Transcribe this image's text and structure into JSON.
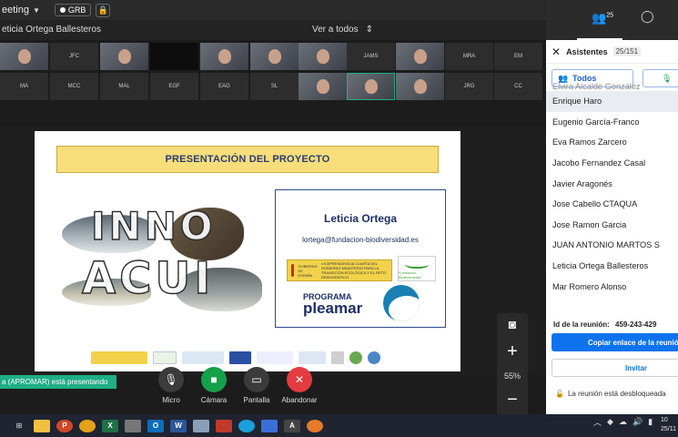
{
  "topbar": {
    "meeting_label": "eeting",
    "recording_badge": "GRB"
  },
  "subbar": {
    "presenter_name": "eticia Ortega Ballesteros",
    "view_label": "Ver a todos"
  },
  "thumbs": {
    "row1": [
      "",
      "JFC",
      "",
      "",
      "",
      "",
      "",
      "JAMS",
      "",
      "MRA",
      "EM"
    ],
    "row2": [
      "MA",
      "MCC",
      "MAL",
      "EGF",
      "EAG",
      "SL",
      "",
      "",
      "",
      "JRG",
      "CC"
    ]
  },
  "slide": {
    "title": "PRESENTACIÓN DEL PROYECTO",
    "person": "Leticia Ortega",
    "email": "lortega@fundacion-biodiversidad.es",
    "gob_text": "VICEPRESIDENCIA CUARTA DEL GOBIERNO MINISTERIO PARA LA TRANSICIÓN ECOLÓGICA Y EL RETO DEMOGRÁFICO",
    "gob_label": "GOBIERNO DE ESPAÑA",
    "fb_label": "Fundación Biodiversidad",
    "programa": "PROGRAMA",
    "pleamar": "pleamar",
    "logo_top": "INNO",
    "logo_bottom": "ACUI"
  },
  "controls": {
    "zoom": "55%"
  },
  "presenting_banner": "a (APROMAR) está presentando",
  "bottom": {
    "mic": "Micro",
    "camera": "Cámara",
    "screen": "Pantalla",
    "leave": "Abandonar"
  },
  "panel": {
    "people_count": "25",
    "title": "Asistentes",
    "count": "25/151",
    "filter_all": "Todos",
    "participants": [
      "Elvira Alcalde González",
      "Enrique Haro",
      "Eugenio García-Franco",
      "Eva Ramos Zarcero",
      "Jacobo Fernandez Casal",
      "Javier Aragonés",
      "Jose Cabello CTAQUA",
      "Jose Ramon Garcia",
      "JUAN ANTONIO MARTOS S",
      "Leticia Ortega Ballesteros",
      "Mar Romero Alonso"
    ],
    "meeting_id_label": "Id de la reunión:",
    "meeting_id": "459-243-429",
    "copy_link": "Copiar enlace de la reunió",
    "invite": "Invitar",
    "unlocked": "La reunión está desbloqueada"
  },
  "taskbar": {
    "time": "10",
    "date": "25/11"
  },
  "colors": {
    "accent": "#0e72ed",
    "present": "#1fae86",
    "leave": "#e23b40",
    "camera": "#15a04a"
  }
}
